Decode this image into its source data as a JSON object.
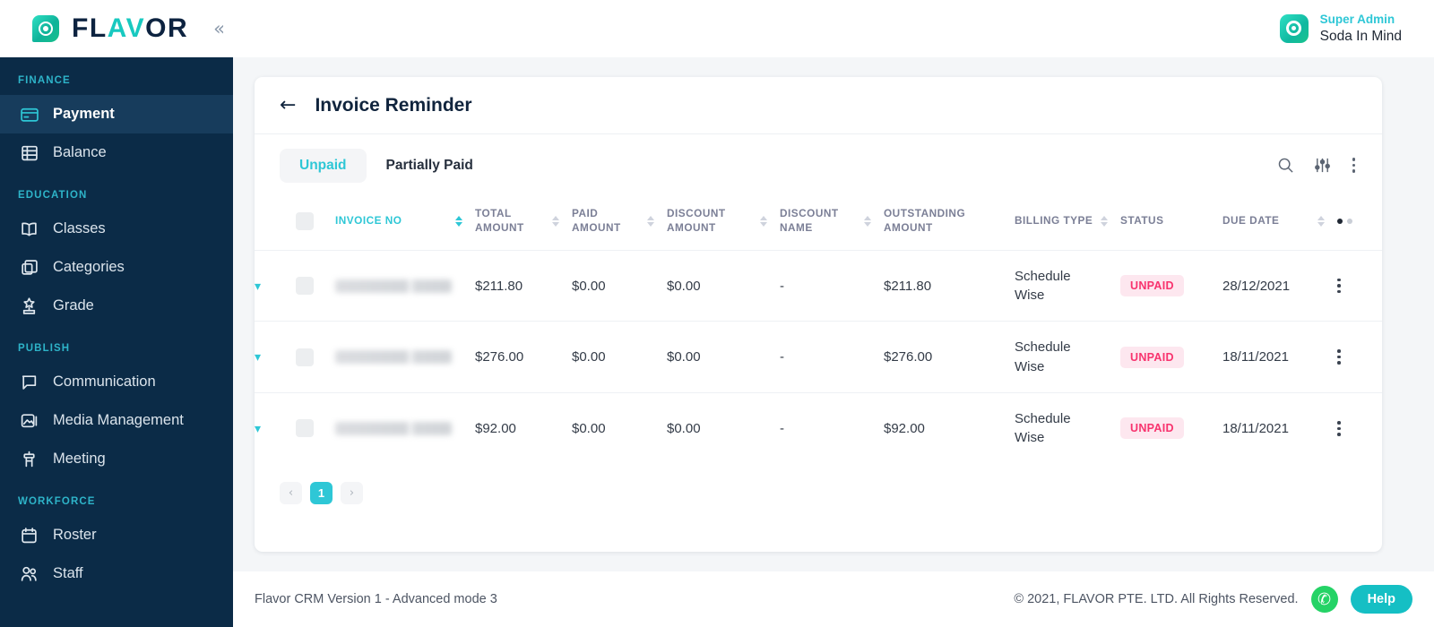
{
  "brand": {
    "name_dark_1": "FL",
    "name_teal": "AV",
    "name_dark_2": "OR",
    "collapse_label": "«"
  },
  "user": {
    "role": "Super Admin",
    "name": "Soda In Mind"
  },
  "sidebar": {
    "sections": [
      {
        "label": "FINANCE",
        "items": [
          {
            "label": "Payment",
            "icon": "credit-card-icon",
            "active": true
          },
          {
            "label": "Balance",
            "icon": "bank-ledger-icon",
            "active": false
          }
        ]
      },
      {
        "label": "EDUCATION",
        "items": [
          {
            "label": "Classes",
            "icon": "open-book-icon",
            "active": false
          },
          {
            "label": "Categories",
            "icon": "boxes-icon",
            "active": false
          },
          {
            "label": "Grade",
            "icon": "hierarchy-icon",
            "active": false
          }
        ]
      },
      {
        "label": "PUBLISH",
        "items": [
          {
            "label": "Communication",
            "icon": "chat-bubble-icon",
            "active": false
          },
          {
            "label": "Media Management",
            "icon": "image-stack-icon",
            "active": false
          },
          {
            "label": "Meeting",
            "icon": "podium-icon",
            "active": false
          }
        ]
      },
      {
        "label": "WORKFORCE",
        "items": [
          {
            "label": "Roster",
            "icon": "calendar-icon",
            "active": false
          },
          {
            "label": "Staff",
            "icon": "people-icon",
            "active": false
          }
        ]
      }
    ]
  },
  "page": {
    "back_label": "←",
    "title": "Invoice Reminder"
  },
  "tabs": [
    {
      "label": "Unpaid",
      "active": true
    },
    {
      "label": "Partially Paid",
      "active": false
    }
  ],
  "toolbar": {
    "search": "search-icon",
    "filter": "filter-sliders-icon",
    "more": "more-vertical-icon"
  },
  "table": {
    "columns": [
      {
        "label": "INVOICE NO",
        "sortable": true,
        "sort_active": true
      },
      {
        "label": "TOTAL AMOUNT",
        "sortable": true,
        "sort_active": false
      },
      {
        "label": "PAID AMOUNT",
        "sortable": true,
        "sort_active": false
      },
      {
        "label": "DISCOUNT AMOUNT",
        "sortable": true,
        "sort_active": false
      },
      {
        "label": "DISCOUNT NAME",
        "sortable": true,
        "sort_active": false
      },
      {
        "label": "OUTSTANDING AMOUNT",
        "sortable": false,
        "sort_active": false
      },
      {
        "label": "BILLING TYPE",
        "sortable": true,
        "sort_active": false
      },
      {
        "label": "STATUS",
        "sortable": false,
        "sort_active": false
      },
      {
        "label": "DUE DATE",
        "sortable": true,
        "sort_active": false
      }
    ],
    "rows": [
      {
        "invoice_no": "",
        "total_amount": "$211.80",
        "paid_amount": "$0.00",
        "discount_amount": "$0.00",
        "discount_name": "-",
        "outstanding_amount": "$211.80",
        "billing_type": "Schedule Wise",
        "status": "UNPAID",
        "due_date": "28/12/2021"
      },
      {
        "invoice_no": "",
        "total_amount": "$276.00",
        "paid_amount": "$0.00",
        "discount_amount": "$0.00",
        "discount_name": "-",
        "outstanding_amount": "$276.00",
        "billing_type": "Schedule Wise",
        "status": "UNPAID",
        "due_date": "18/11/2021"
      },
      {
        "invoice_no": "",
        "total_amount": "$92.00",
        "paid_amount": "$0.00",
        "discount_amount": "$0.00",
        "discount_name": "-",
        "outstanding_amount": "$92.00",
        "billing_type": "Schedule Wise",
        "status": "UNPAID",
        "due_date": "18/11/2021"
      }
    ]
  },
  "pagination": {
    "prev": "‹",
    "current": "1",
    "next": "›"
  },
  "footer": {
    "version": "Flavor CRM Version 1 - Advanced mode 3",
    "copyright": "© 2021, FLAVOR PTE. LTD. All Rights Reserved.",
    "whatsapp_icon": "whatsapp-icon",
    "help_label": "Help"
  },
  "colors": {
    "accent": "#2ec7d6",
    "sidebar": "#0b2b47",
    "status_unpaid": "#f8336e",
    "whatsapp": "#25d366"
  }
}
